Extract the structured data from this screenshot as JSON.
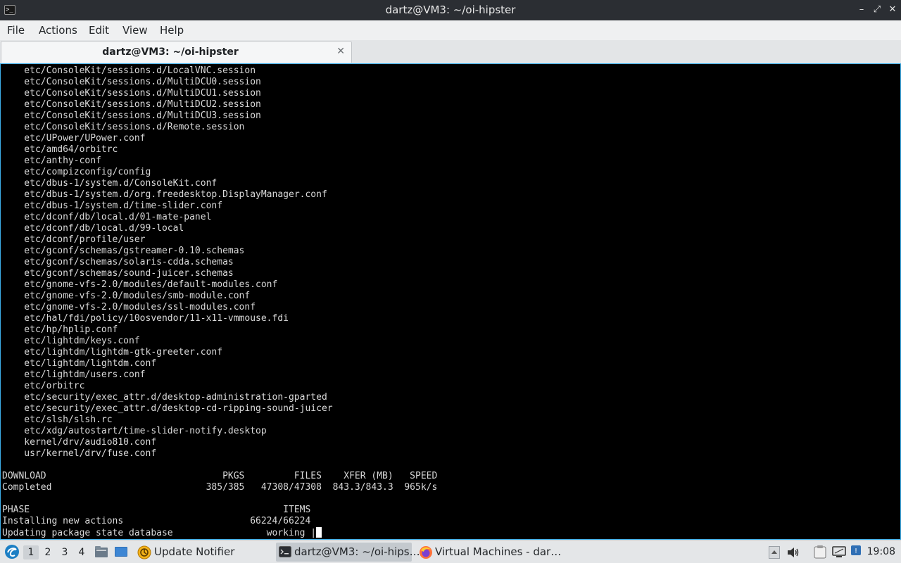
{
  "window": {
    "title": "dartz@VM3: ~/oi-hipster",
    "app_icon": "terminal-icon",
    "controls": {
      "minimize": "–",
      "maximize": "⤢",
      "close": "✕"
    }
  },
  "menubar": {
    "items": [
      "File",
      "Actions",
      "Edit",
      "View",
      "Help"
    ]
  },
  "tabs": [
    {
      "title": "dartz@VM3: ~/oi-hipster",
      "close": "✕"
    }
  ],
  "terminal": {
    "lines": [
      "    etc/ConsoleKit/sessions.d/LocalVNC.session",
      "    etc/ConsoleKit/sessions.d/MultiDCU0.session",
      "    etc/ConsoleKit/sessions.d/MultiDCU1.session",
      "    etc/ConsoleKit/sessions.d/MultiDCU2.session",
      "    etc/ConsoleKit/sessions.d/MultiDCU3.session",
      "    etc/ConsoleKit/sessions.d/Remote.session",
      "    etc/UPower/UPower.conf",
      "    etc/amd64/orbitrc",
      "    etc/anthy-conf",
      "    etc/compizconfig/config",
      "    etc/dbus-1/system.d/ConsoleKit.conf",
      "    etc/dbus-1/system.d/org.freedesktop.DisplayManager.conf",
      "    etc/dbus-1/system.d/time-slider.conf",
      "    etc/dconf/db/local.d/01-mate-panel",
      "    etc/dconf/db/local.d/99-local",
      "    etc/dconf/profile/user",
      "    etc/gconf/schemas/gstreamer-0.10.schemas",
      "    etc/gconf/schemas/solaris-cdda.schemas",
      "    etc/gconf/schemas/sound-juicer.schemas",
      "    etc/gnome-vfs-2.0/modules/default-modules.conf",
      "    etc/gnome-vfs-2.0/modules/smb-module.conf",
      "    etc/gnome-vfs-2.0/modules/ssl-modules.conf",
      "    etc/hal/fdi/policy/10osvendor/11-x11-vmmouse.fdi",
      "    etc/hp/hplip.conf",
      "    etc/lightdm/keys.conf",
      "    etc/lightdm/lightdm-gtk-greeter.conf",
      "    etc/lightdm/lightdm.conf",
      "    etc/lightdm/users.conf",
      "    etc/orbitrc",
      "    etc/security/exec_attr.d/desktop-administration-gparted",
      "    etc/security/exec_attr.d/desktop-cd-ripping-sound-juicer",
      "    etc/slsh/slsh.rc",
      "    etc/xdg/autostart/time-slider-notify.desktop",
      "    kernel/drv/audio810.conf",
      "    usr/kernel/drv/fuse.conf",
      "",
      "DOWNLOAD                                PKGS         FILES    XFER (MB)   SPEED",
      "Completed                            385/385   47308/47308  843.3/843.3  965k/s",
      "",
      "PHASE                                              ITEMS",
      "Installing new actions                       66224/66224",
      "Updating package state database                 working |"
    ]
  },
  "taskbar": {
    "start_icon": "start-menu-icon",
    "workspaces": [
      "1",
      "2",
      "3",
      "4"
    ],
    "active_workspace": "1",
    "quicklaunch": [
      "file-manager-icon",
      "show-desktop-icon"
    ],
    "tasks": [
      {
        "label": "Update Notifier",
        "icon": "update-notifier-icon",
        "active": false
      },
      {
        "label": "dartz@VM3: ~/oi-hips…",
        "icon": "terminal-icon",
        "active": true
      },
      {
        "label": "Virtual Machines - dar…",
        "icon": "firefox-icon",
        "active": false
      }
    ],
    "tray": [
      "tray-up-icon",
      "volume-icon",
      "clipboard-icon",
      "network-icon",
      "notification-icon"
    ],
    "clock": "19:08"
  },
  "colors": {
    "terminal_bg": "#000000",
    "terminal_fg": "#d9d9d9",
    "accent": "#3daee9",
    "titlebar_bg": "#2b2e33"
  }
}
